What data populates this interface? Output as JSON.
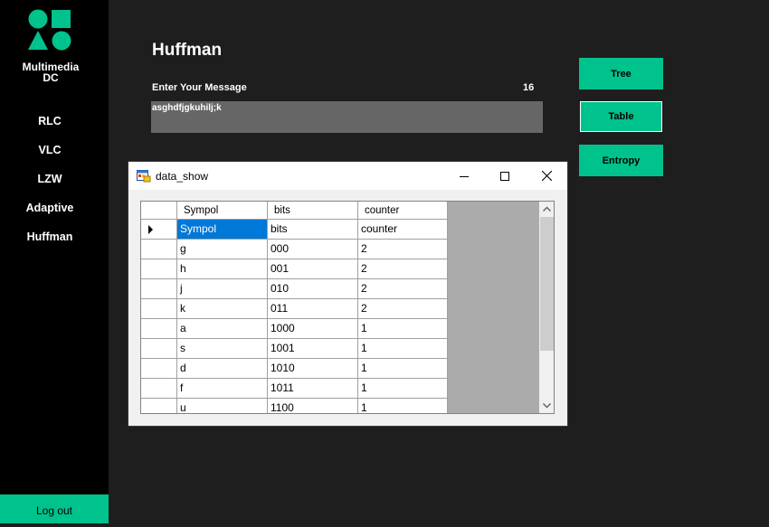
{
  "sidebar": {
    "app_name_line1": "Multimedia",
    "app_name_line2": "DC",
    "items": [
      {
        "label": "RLC"
      },
      {
        "label": "VLC"
      },
      {
        "label": "LZW"
      },
      {
        "label": "Adaptive"
      },
      {
        "label": "Huffman"
      }
    ],
    "logout_label": "Log out"
  },
  "main": {
    "title": "Huffman",
    "message_label": "Enter Your Message",
    "message_length": "16",
    "message_value": "asghdfjgkuhilj;k",
    "buttons": {
      "tree": "Tree",
      "table": "Table",
      "entropy": "Entropy"
    }
  },
  "dialog": {
    "title": "data_show",
    "columns": [
      "Sympol",
      "bits",
      "counter"
    ],
    "rows": [
      [
        "Sympol",
        "bits",
        "counter"
      ],
      [
        "g",
        "000",
        "2"
      ],
      [
        "h",
        "001",
        "2"
      ],
      [
        "j",
        "010",
        "2"
      ],
      [
        "k",
        "011",
        "2"
      ],
      [
        "a",
        "1000",
        "1"
      ],
      [
        "s",
        "1001",
        "1"
      ],
      [
        "d",
        "1010",
        "1"
      ],
      [
        "f",
        "1011",
        "1"
      ],
      [
        "u",
        "1100",
        "1"
      ]
    ]
  },
  "colors": {
    "accent": "#00c28c",
    "sidebar_bg": "#000000",
    "main_bg": "#1e1e1e",
    "input_bg": "#666666",
    "selection": "#0078d7"
  },
  "icons": {
    "logo": "shapes-logo-icon",
    "row_indicator": "current-row-triangle-icon",
    "minimize": "minimize-icon",
    "maximize": "maximize-icon",
    "close": "close-icon",
    "scroll_up": "chevron-up-icon",
    "scroll_down": "chevron-down-icon"
  }
}
